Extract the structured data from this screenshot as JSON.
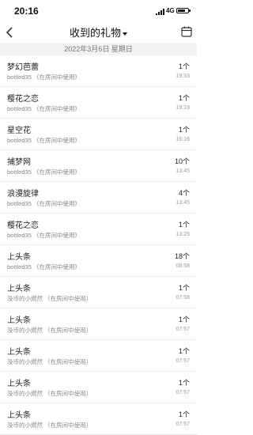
{
  "status_bar": {
    "time": "20:16",
    "network": "4G"
  },
  "nav": {
    "title": "收到的礼物"
  },
  "date_header": "2022年3月6日 星期日",
  "gifts": [
    {
      "name": "梦幻芭蕾",
      "sender": "bottled35 （在房间中使用）",
      "qty": "1个",
      "time": "19:33"
    },
    {
      "name": "樱花之恋",
      "sender": "bottled35 （在房间中使用）",
      "qty": "1个",
      "time": "19:19"
    },
    {
      "name": "星空花",
      "sender": "bottled35 （在房间中使用）",
      "qty": "1个",
      "time": "16:16"
    },
    {
      "name": "捕梦网",
      "sender": "bottled35 （在房间中使用）",
      "qty": "10个",
      "time": "13:45"
    },
    {
      "name": "浪漫旋律",
      "sender": "bottled35 （在房间中使用）",
      "qty": "4个",
      "time": "13:45"
    },
    {
      "name": "樱花之恋",
      "sender": "bottled35 （在房间中使用）",
      "qty": "1个",
      "time": "13:25"
    },
    {
      "name": "上头条",
      "sender": "bottled35 （在房间中使用）",
      "qty": "18个",
      "time": "08:58"
    },
    {
      "name": "上头条",
      "sender": "没币的小燃然 （在房间中使用）",
      "qty": "1个",
      "time": "07:58"
    },
    {
      "name": "上头条",
      "sender": "没币的小燃然 （在房间中使用）",
      "qty": "1个",
      "time": "07:57"
    },
    {
      "name": "上头条",
      "sender": "没币的小燃然 （在房间中使用）",
      "qty": "1个",
      "time": "07:57"
    },
    {
      "name": "上头条",
      "sender": "没币的小燃然 （在房间中使用）",
      "qty": "1个",
      "time": "07:57"
    },
    {
      "name": "上头条",
      "sender": "没币的小燃然 （在房间中使用）",
      "qty": "1个",
      "time": "07:57"
    }
  ]
}
